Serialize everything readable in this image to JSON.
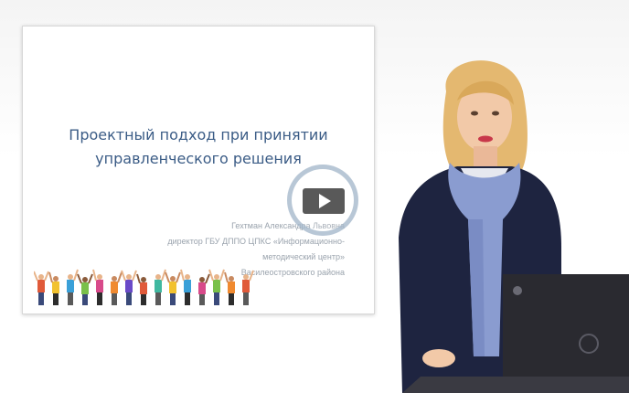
{
  "slide": {
    "title_line1": "Проектный подход при принятии",
    "title_line2": "управленческого решения",
    "author_name": "Гехтман Александра Львовна",
    "author_position": "директор ГБУ ДППО ЦПКС «Информационно-методический центр»",
    "author_district": "Василеостровского района"
  },
  "player": {
    "play_icon": "play-icon"
  },
  "colors": {
    "title": "#3b5c86",
    "author": "#9aa3ad",
    "play_box": "#3c3c3c"
  }
}
